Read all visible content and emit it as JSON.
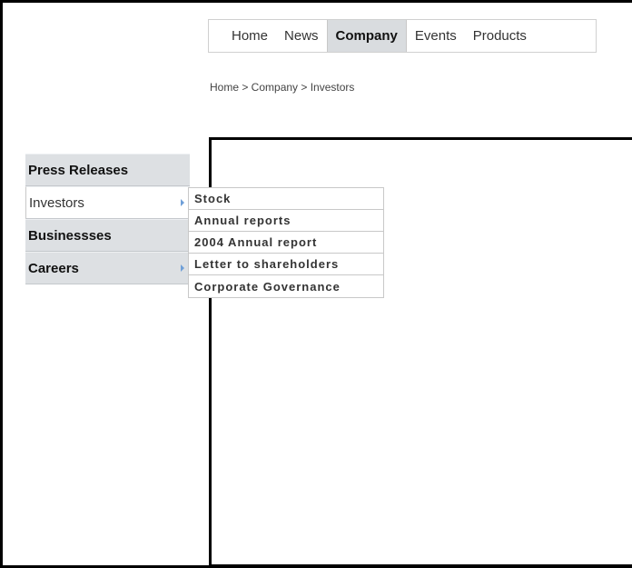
{
  "top_nav": {
    "items": [
      {
        "label": "Home"
      },
      {
        "label": "News"
      },
      {
        "label": "Company",
        "active": true
      },
      {
        "label": "Events"
      },
      {
        "label": "Products"
      }
    ]
  },
  "breadcrumb": "Home > Company > Investors",
  "left_menu": {
    "items": [
      {
        "label": "Press Releases"
      },
      {
        "label": "Investors",
        "active": true,
        "has_submenu": true
      },
      {
        "label": "Businessses"
      },
      {
        "label": "Careers",
        "has_submenu": true
      }
    ]
  },
  "submenu": {
    "items": [
      {
        "label": "Stock"
      },
      {
        "label": "Annual reports"
      },
      {
        "label": "2004 Annual report"
      },
      {
        "label": "Letter to shareholders"
      },
      {
        "label": "Corporate Governance"
      }
    ]
  },
  "colors": {
    "menu_bg": "#dde0e3",
    "active_tab_bg": "#d9dcdf",
    "arrow": "#6f9fd8"
  }
}
